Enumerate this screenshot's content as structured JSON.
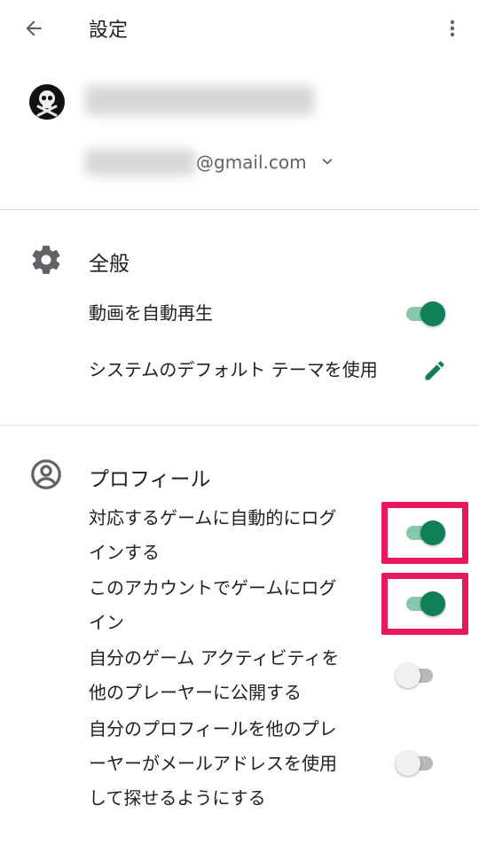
{
  "header": {
    "title": "設定",
    "back_icon": "arrow-left-icon",
    "menu_icon": "more-vert-icon"
  },
  "account": {
    "avatar_icon": "skull-crossbones-icon",
    "email_suffix": "@gmail.com",
    "dropdown_icon": "chevron-down-icon"
  },
  "general": {
    "title": "全般",
    "icon": "gear-icon",
    "settings": [
      {
        "label": "動画を自動再生",
        "type": "toggle",
        "on": true
      },
      {
        "label": "システムのデフォルト テーマを使用",
        "type": "edit",
        "icon": "pencil-icon"
      }
    ]
  },
  "profile": {
    "title": "プロフィール",
    "icon": "account-circle-icon",
    "settings": [
      {
        "line1": "対応するゲームに自動的にログ",
        "line2": "インする",
        "on": true,
        "highlighted": true
      },
      {
        "line1": "このアカウントでゲームにログ",
        "line2": "イン",
        "on": true,
        "highlighted": true
      },
      {
        "line1": "自分のゲーム アクティビティを",
        "line2": "他のプレーヤーに公開する",
        "on": false,
        "highlighted": false
      },
      {
        "line1": "自分のプロフィールを他のプレ",
        "line2": "ーヤーがメールアドレスを使用",
        "line3": "して探せるようにする",
        "on": false,
        "highlighted": false
      }
    ]
  },
  "colors": {
    "accent": "#0f7f55",
    "accent_track": "#86c8a9",
    "highlight": "#e8185f",
    "divider": "#e0e0e0"
  }
}
